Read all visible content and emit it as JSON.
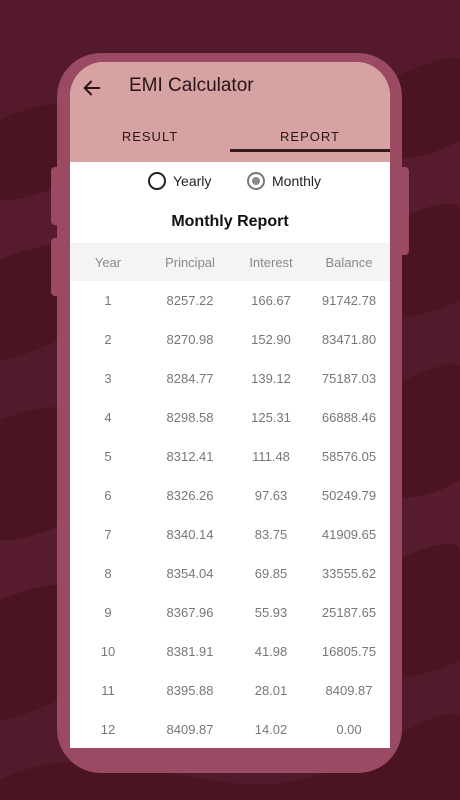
{
  "app": {
    "title": "EMI Calculator"
  },
  "tabs": [
    {
      "label": "RESULT",
      "active": false
    },
    {
      "label": "REPORT",
      "active": true
    }
  ],
  "report_type": {
    "options": [
      {
        "label": "Yearly",
        "selected": false
      },
      {
        "label": "Monthly",
        "selected": true
      }
    ]
  },
  "report": {
    "title": "Monthly Report",
    "columns": [
      "Year",
      "Principal",
      "Interest",
      "Balance"
    ],
    "rows": [
      [
        "1",
        "8257.22",
        "166.67",
        "91742.78"
      ],
      [
        "2",
        "8270.98",
        "152.90",
        "83471.80"
      ],
      [
        "3",
        "8284.77",
        "139.12",
        "75187.03"
      ],
      [
        "4",
        "8298.58",
        "125.31",
        "66888.46"
      ],
      [
        "5",
        "8312.41",
        "111.48",
        "58576.05"
      ],
      [
        "6",
        "8326.26",
        "97.63",
        "50249.79"
      ],
      [
        "7",
        "8340.14",
        "83.75",
        "41909.65"
      ],
      [
        "8",
        "8354.04",
        "69.85",
        "33555.62"
      ],
      [
        "9",
        "8367.96",
        "55.93",
        "25187.65"
      ],
      [
        "10",
        "8381.91",
        "41.98",
        "16805.75"
      ],
      [
        "11",
        "8395.88",
        "28.01",
        "8409.87"
      ],
      [
        "12",
        "8409.87",
        "14.02",
        "0.00"
      ]
    ]
  },
  "colors": {
    "background": "#4a1423",
    "phone_frame": "#9a4a62",
    "app_bar": "#d6a3a2",
    "tab_indicator": "#3a1820"
  },
  "icons": {
    "back": "arrow-left-icon"
  }
}
